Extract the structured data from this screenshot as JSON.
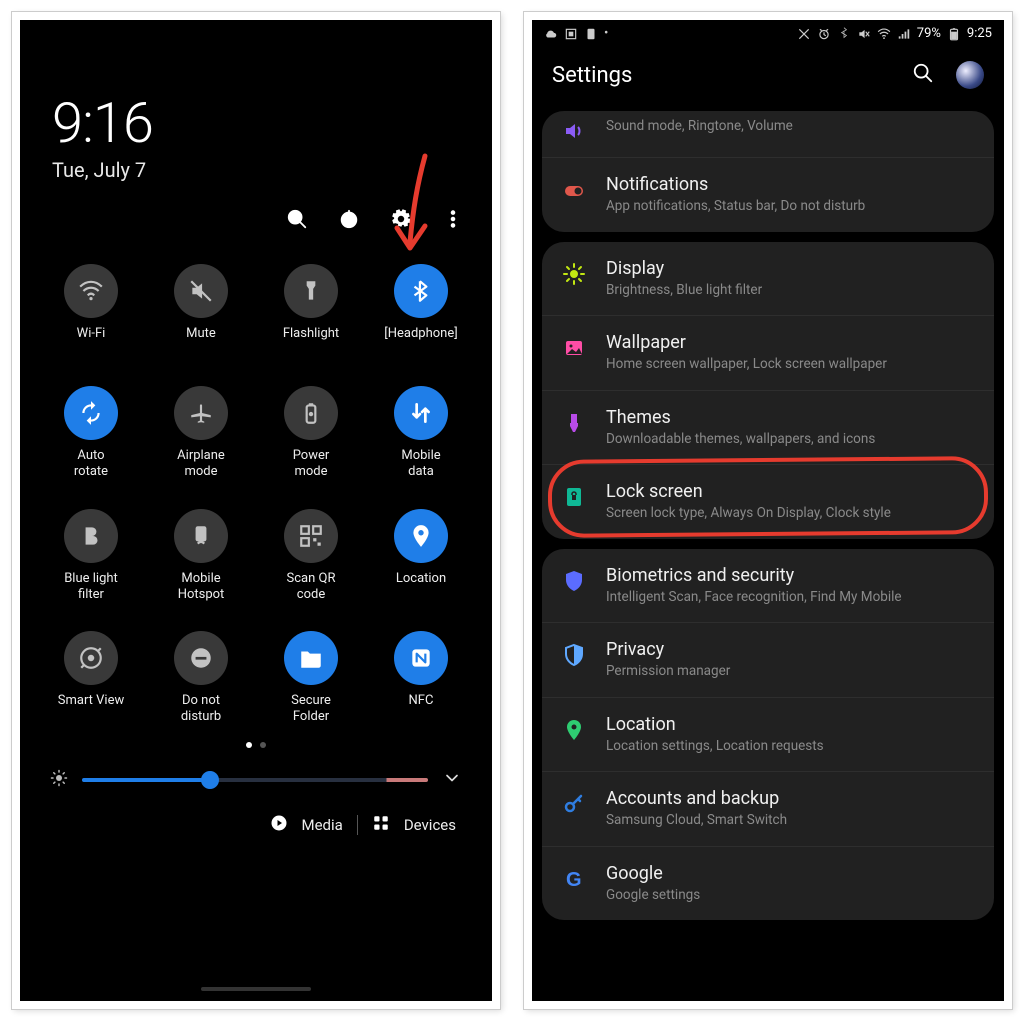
{
  "left": {
    "time": "9:16",
    "date": "Tue, July 7",
    "actions": {
      "search": "search-icon",
      "power": "power-icon",
      "settings": "gear-icon",
      "more": "more-vert-icon"
    },
    "tiles": [
      {
        "name": "wifi",
        "label": "Wi-Fi",
        "active": false,
        "icon": "wifi"
      },
      {
        "name": "mute",
        "label": "Mute",
        "active": false,
        "icon": "mute"
      },
      {
        "name": "flashlight",
        "label": "Flashlight",
        "active": false,
        "icon": "flashlight"
      },
      {
        "name": "bluetooth",
        "label": "[Headphone]",
        "active": true,
        "icon": "bluetooth"
      },
      {
        "name": "auto-rotate",
        "label": "Auto\nrotate",
        "active": true,
        "icon": "rotate"
      },
      {
        "name": "airplane",
        "label": "Airplane\nmode",
        "active": false,
        "icon": "airplane"
      },
      {
        "name": "power-mode",
        "label": "Power\nmode",
        "active": false,
        "icon": "battery"
      },
      {
        "name": "mobile-data",
        "label": "Mobile\ndata",
        "active": true,
        "icon": "data"
      },
      {
        "name": "blue-light",
        "label": "Blue light\nfilter",
        "active": false,
        "icon": "bold"
      },
      {
        "name": "hotspot",
        "label": "Mobile\nHotspot",
        "active": false,
        "icon": "hotspot"
      },
      {
        "name": "qr",
        "label": "Scan QR\ncode",
        "active": false,
        "icon": "qr"
      },
      {
        "name": "location",
        "label": "Location",
        "active": true,
        "icon": "pin"
      },
      {
        "name": "smart-view",
        "label": "Smart View",
        "active": false,
        "icon": "cast"
      },
      {
        "name": "dnd",
        "label": "Do not\ndisturb",
        "active": false,
        "icon": "dnd"
      },
      {
        "name": "secure-folder",
        "label": "Secure\nFolder",
        "active": true,
        "icon": "folder"
      },
      {
        "name": "nfc",
        "label": "NFC",
        "active": true,
        "icon": "nfc"
      }
    ],
    "brightness_percent": 37,
    "media_label": "Media",
    "devices_label": "Devices"
  },
  "right": {
    "statusbar": {
      "battery_text": "79%",
      "clock": "9:25"
    },
    "title": "Settings",
    "groups": [
      {
        "rows": [
          {
            "name": "sounds",
            "icon": "speaker",
            "color": "#8b5cf6",
            "title": "",
            "subtitle": "Sound mode, Ringtone, Volume",
            "partial": true
          },
          {
            "name": "notifications",
            "icon": "toggle",
            "color": "#e0574b",
            "title": "Notifications",
            "subtitle": "App notifications, Status bar, Do not disturb"
          }
        ]
      },
      {
        "highlight_index": 3,
        "rows": [
          {
            "name": "display",
            "icon": "sun",
            "color": "#c2e812",
            "title": "Display",
            "subtitle": "Brightness, Blue light filter"
          },
          {
            "name": "wallpaper",
            "icon": "image",
            "color": "#ff4da6",
            "title": "Wallpaper",
            "subtitle": "Home screen wallpaper, Lock screen wallpaper"
          },
          {
            "name": "themes",
            "icon": "brush",
            "color": "#b84be8",
            "title": "Themes",
            "subtitle": "Downloadable themes, wallpapers, and icons"
          },
          {
            "name": "lock-screen",
            "icon": "lock",
            "color": "#0fb895",
            "title": "Lock screen",
            "subtitle": "Screen lock type, Always On Display, Clock style"
          }
        ]
      },
      {
        "rows": [
          {
            "name": "biometrics",
            "icon": "shield",
            "color": "#5b6cff",
            "title": "Biometrics and security",
            "subtitle": "Intelligent Scan, Face recognition, Find My Mobile"
          },
          {
            "name": "privacy",
            "icon": "shield2",
            "color": "#5fa8ff",
            "title": "Privacy",
            "subtitle": "Permission manager"
          },
          {
            "name": "location",
            "icon": "pin",
            "color": "#2ecc71",
            "title": "Location",
            "subtitle": "Location settings, Location requests"
          },
          {
            "name": "accounts",
            "icon": "key",
            "color": "#2f7de0",
            "title": "Accounts and backup",
            "subtitle": "Samsung Cloud, Smart Switch"
          },
          {
            "name": "google",
            "icon": "google",
            "color": "#4285f4",
            "title": "Google",
            "subtitle": "Google settings"
          }
        ]
      }
    ]
  }
}
